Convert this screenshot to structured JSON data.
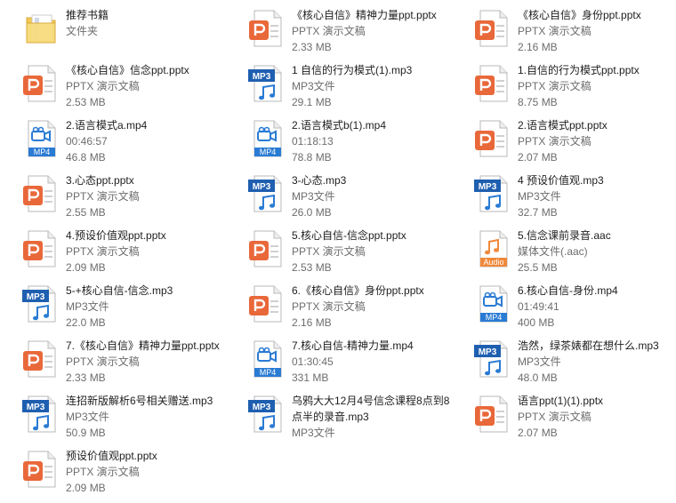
{
  "files": [
    {
      "name": "推荐书籍",
      "line2": "文件夹",
      "line3": "",
      "kind": "folder"
    },
    {
      "name": "《核心自信》精神力量ppt.pptx",
      "line2": "PPTX 演示文稿",
      "line3": "2.33 MB",
      "kind": "pptx"
    },
    {
      "name": "《核心自信》身份ppt.pptx",
      "line2": "PPTX 演示文稿",
      "line3": "2.16 MB",
      "kind": "pptx"
    },
    {
      "name": "《核心自信》信念ppt.pptx",
      "line2": "PPTX 演示文稿",
      "line3": "2.53 MB",
      "kind": "pptx"
    },
    {
      "name": "1 自信的行为模式(1).mp3",
      "line2": "MP3文件",
      "line3": "29.1 MB",
      "kind": "mp3"
    },
    {
      "name": "1.自信的行为模式ppt.pptx",
      "line2": "PPTX 演示文稿",
      "line3": "8.75 MB",
      "kind": "pptx"
    },
    {
      "name": "2.语言模式a.mp4",
      "line2": "00:46:57",
      "line3": "46.8 MB",
      "kind": "mp4"
    },
    {
      "name": "2.语言模式b(1).mp4",
      "line2": "01:18:13",
      "line3": "78.8 MB",
      "kind": "mp4"
    },
    {
      "name": "2.语言模式ppt.pptx",
      "line2": "PPTX 演示文稿",
      "line3": "2.07 MB",
      "kind": "pptx"
    },
    {
      "name": "3.心态ppt.pptx",
      "line2": "PPTX 演示文稿",
      "line3": "2.55 MB",
      "kind": "pptx"
    },
    {
      "name": "3-心态.mp3",
      "line2": "MP3文件",
      "line3": "26.0 MB",
      "kind": "mp3"
    },
    {
      "name": "4 预设价值观.mp3",
      "line2": "MP3文件",
      "line3": "32.7 MB",
      "kind": "mp3"
    },
    {
      "name": "4.预设价值观ppt.pptx",
      "line2": "PPTX 演示文稿",
      "line3": "2.09 MB",
      "kind": "pptx"
    },
    {
      "name": "5.核心自信-信念ppt.pptx",
      "line2": "PPTX 演示文稿",
      "line3": "2.53 MB",
      "kind": "pptx"
    },
    {
      "name": "5.信念课前录音.aac",
      "line2": "媒体文件(.aac)",
      "line3": "25.5 MB",
      "kind": "aac"
    },
    {
      "name": "5-+核心自信-信念.mp3",
      "line2": "MP3文件",
      "line3": "22.0 MB",
      "kind": "mp3"
    },
    {
      "name": "6.《核心自信》身份ppt.pptx",
      "line2": "PPTX 演示文稿",
      "line3": "2.16 MB",
      "kind": "pptx"
    },
    {
      "name": "6.核心自信-身份.mp4",
      "line2": "01:49:41",
      "line3": "400 MB",
      "kind": "mp4"
    },
    {
      "name": "7.《核心自信》精神力量ppt.pptx",
      "line2": "PPTX 演示文稿",
      "line3": "2.33 MB",
      "kind": "pptx"
    },
    {
      "name": "7.核心自信-精神力量.mp4",
      "line2": "01:30:45",
      "line3": "331 MB",
      "kind": "mp4"
    },
    {
      "name": "浩然，绿茶婊都在想什么.mp3",
      "line2": "MP3文件",
      "line3": "48.0 MB",
      "kind": "mp3"
    },
    {
      "name": "连招新版解析6号相关赠送.mp3",
      "line2": "MP3文件",
      "line3": "50.9 MB",
      "kind": "mp3"
    },
    {
      "name": "乌鸦大大12月4号信念课程8点到8点半的录音.mp3",
      "line2": "MP3文件",
      "line3": "",
      "kind": "mp3",
      "wrap": true
    },
    {
      "name": "语言ppt(1)(1).pptx",
      "line2": "PPTX 演示文稿",
      "line3": "2.07 MB",
      "kind": "pptx"
    },
    {
      "name": "预设价值观ppt.pptx",
      "line2": "PPTX 演示文稿",
      "line3": "2.09 MB",
      "kind": "pptx"
    }
  ],
  "icon_labels": {
    "mp3": "MP3",
    "mp4": "MP4",
    "audio": "Audio"
  },
  "colors": {
    "ppt_orange": "#e9683a",
    "media_blue": "#2a7bd4",
    "aac_orange": "#f0883a",
    "folder_yellow": "#f3c956"
  }
}
